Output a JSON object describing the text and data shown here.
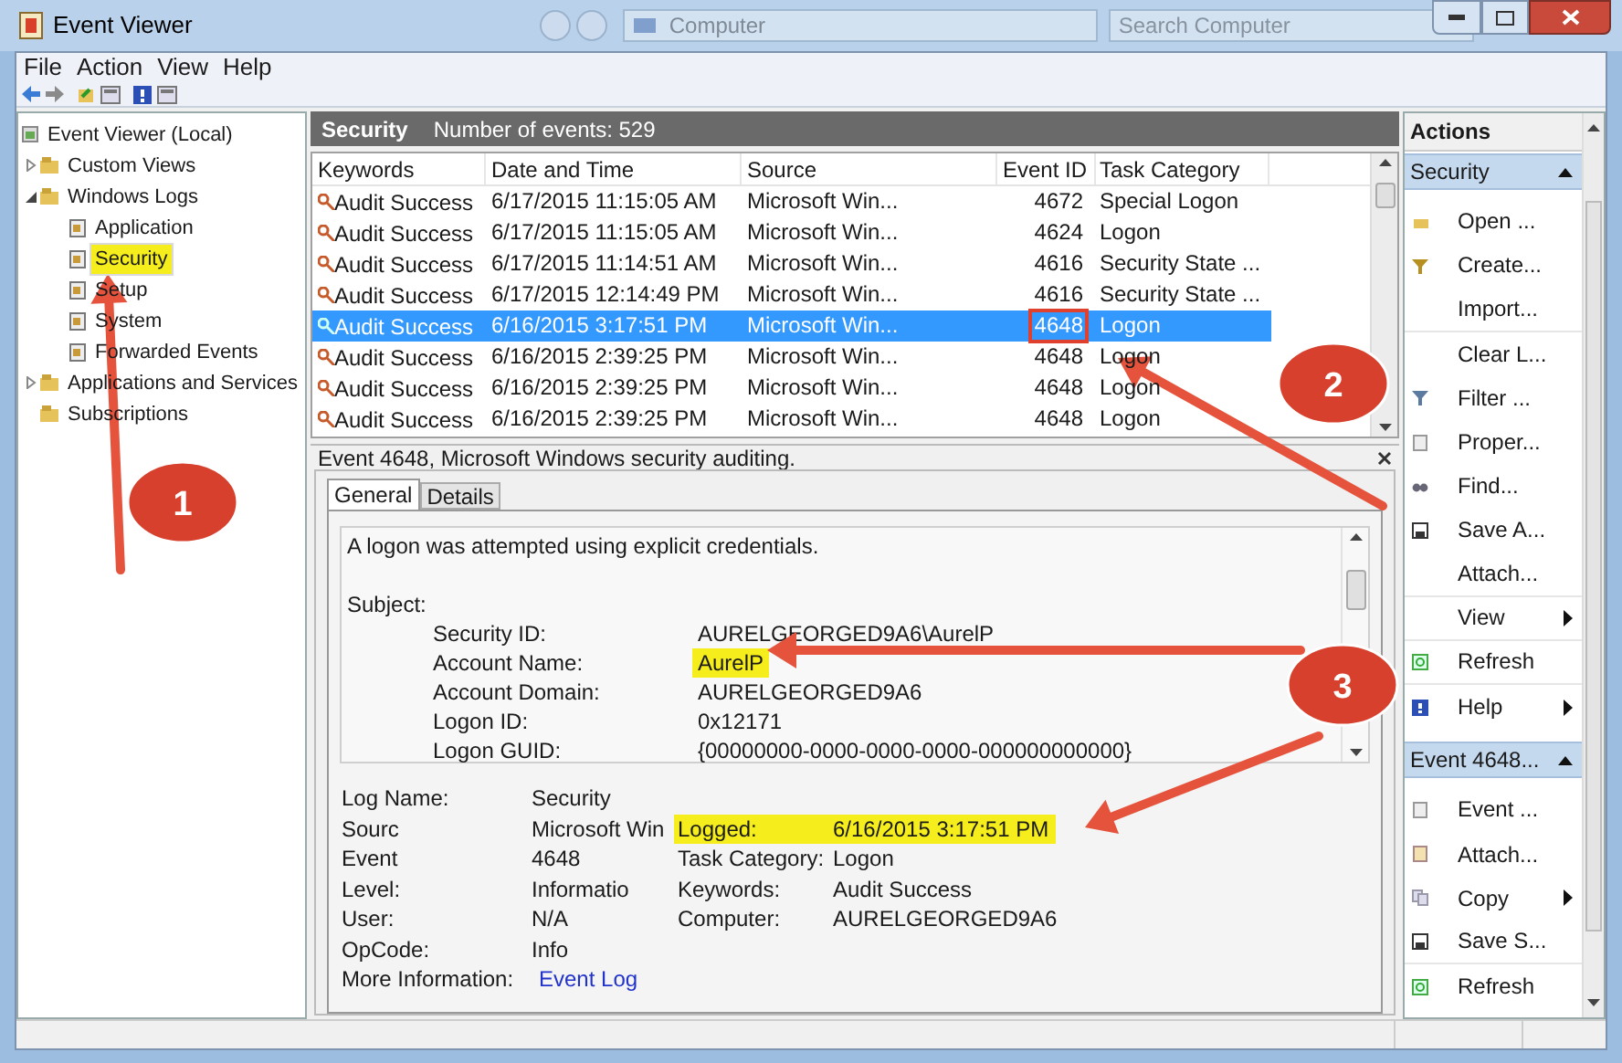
{
  "window": {
    "title": "Event Viewer"
  },
  "background_window": {
    "address": "Computer",
    "search_placeholder": "Search Computer"
  },
  "menu": [
    "File",
    "Action",
    "View",
    "Help"
  ],
  "tree": [
    {
      "label": "Event Viewer (Local)",
      "selected": false,
      "highlighted": false,
      "children": [
        {
          "label": "Custom Views",
          "expanded": false,
          "selected": false,
          "highlighted": false
        },
        {
          "label": "Windows Logs",
          "expanded": true,
          "selected": false,
          "highlighted": false,
          "children": [
            {
              "label": "Application",
              "selected": false,
              "highlighted": false
            },
            {
              "label": "Security",
              "selected": true,
              "highlighted": true
            },
            {
              "label": "Setup",
              "selected": false,
              "highlighted": false
            },
            {
              "label": "System",
              "selected": false,
              "highlighted": false
            },
            {
              "label": "Forwarded Events",
              "selected": false,
              "highlighted": false
            }
          ]
        },
        {
          "label": "Applications and Services",
          "expanded": false,
          "selected": false,
          "highlighted": false
        },
        {
          "label": "Subscriptions",
          "selected": false,
          "highlighted": false
        }
      ]
    }
  ],
  "log_header": {
    "title": "Security",
    "count": "Number of events: 529"
  },
  "table": {
    "columns": [
      "Keywords",
      "Date and Time",
      "Source",
      "Event ID",
      "Task Category"
    ],
    "rows": [
      {
        "keywords": "Audit Success",
        "date": "6/17/2015 11:15:05 AM",
        "source": "Microsoft Win...",
        "event_id": "4672",
        "task": "Special Logon",
        "selected": false,
        "boxed": false
      },
      {
        "keywords": "Audit Success",
        "date": "6/17/2015 11:15:05 AM",
        "source": "Microsoft Win...",
        "event_id": "4624",
        "task": "Logon",
        "selected": false,
        "boxed": false
      },
      {
        "keywords": "Audit Success",
        "date": "6/17/2015 11:14:51 AM",
        "source": "Microsoft Win...",
        "event_id": "4616",
        "task": "Security State ...",
        "selected": false,
        "boxed": false
      },
      {
        "keywords": "Audit Success",
        "date": "6/17/2015 12:14:49 PM",
        "source": "Microsoft Win...",
        "event_id": "4616",
        "task": "Security State ...",
        "selected": false,
        "boxed": false
      },
      {
        "keywords": "Audit Success",
        "date": "6/16/2015 3:17:51 PM",
        "source": "Microsoft Win...",
        "event_id": "4648",
        "task": "Logon",
        "selected": true,
        "boxed": true
      },
      {
        "keywords": "Audit Success",
        "date": "6/16/2015 2:39:25 PM",
        "source": "Microsoft Win...",
        "event_id": "4648",
        "task": "Logon",
        "selected": false,
        "boxed": false
      },
      {
        "keywords": "Audit Success",
        "date": "6/16/2015 2:39:25 PM",
        "source": "Microsoft Win...",
        "event_id": "4648",
        "task": "Logon",
        "selected": false,
        "boxed": false
      },
      {
        "keywords": "Audit Success",
        "date": "6/16/2015 2:39:25 PM",
        "source": "Microsoft Win...",
        "event_id": "4648",
        "task": "Logon",
        "selected": false,
        "boxed": false
      }
    ]
  },
  "detail": {
    "title": "Event 4648, Microsoft Windows security auditing.",
    "tabs": [
      {
        "label": "General",
        "selected": true
      },
      {
        "label": "Details",
        "selected": false
      }
    ],
    "summary": "A logon was attempted using explicit credentials.",
    "section": "Subject:",
    "fields": [
      {
        "label": "Security ID:",
        "value": "AURELGEORGED9A6\\AurelP",
        "highlighted": false
      },
      {
        "label": "Account Name:",
        "value": "AurelP",
        "highlighted": true
      },
      {
        "label": "Account Domain:",
        "value": "AURELGEORGED9A6",
        "highlighted": false
      },
      {
        "label": "Logon ID:",
        "value": "0x12171",
        "highlighted": false
      },
      {
        "label": "Logon GUID:",
        "value": "{00000000-0000-0000-0000-000000000000}",
        "highlighted": false
      }
    ],
    "properties": [
      {
        "label": "Log Name:",
        "value": "Security"
      },
      {
        "label": "Sourc",
        "value": "Microsoft Win",
        "right": {
          "label": "Logged:",
          "value": "6/16/2015 3:17:51 PM",
          "highlighted": true
        }
      },
      {
        "label": "Event",
        "value": "4648",
        "right": {
          "label": "Task Category:",
          "value": "Logon",
          "highlighted": false
        }
      },
      {
        "label": "Level:",
        "value": "Informatio",
        "right": {
          "label": "Keywords:",
          "value": "Audit Success",
          "highlighted": false
        }
      },
      {
        "label": "User:",
        "value": "N/A",
        "right": {
          "label": "Computer:",
          "value": "AURELGEORGED9A6",
          "highlighted": false
        }
      },
      {
        "label": "OpCode:",
        "value": "Info"
      },
      {
        "label": "More Information:",
        "value": "Event Log",
        "kind": "link"
      }
    ]
  },
  "actions": {
    "title": "Actions",
    "sections": [
      {
        "title": "Security",
        "items": [
          {
            "label": "Open ...",
            "submenu": false,
            "separator_after": false
          },
          {
            "label": "Create...",
            "submenu": false,
            "separator_after": false
          },
          {
            "label": "Import...",
            "submenu": false,
            "separator_after": true
          },
          {
            "label": "Clear L...",
            "submenu": false,
            "separator_after": false
          },
          {
            "label": "Filter ...",
            "submenu": false,
            "separator_after": false
          },
          {
            "label": "Proper...",
            "submenu": false,
            "separator_after": false
          },
          {
            "label": "Find...",
            "submenu": false,
            "separator_after": false
          },
          {
            "label": "Save A...",
            "submenu": false,
            "separator_after": false
          },
          {
            "label": "Attach...",
            "submenu": false,
            "separator_after": true
          },
          {
            "label": "View",
            "submenu": true,
            "separator_after": true
          },
          {
            "label": "Refresh",
            "submenu": false,
            "separator_after": true
          },
          {
            "label": "Help",
            "submenu": true,
            "separator_after": false
          }
        ]
      },
      {
        "title": "Event 4648...",
        "items": [
          {
            "label": "Event ...",
            "submenu": false,
            "separator_after": false
          },
          {
            "label": "Attach...",
            "submenu": false,
            "separator_after": false
          },
          {
            "label": "Copy",
            "submenu": true,
            "separator_after": false
          },
          {
            "label": "Save S...",
            "submenu": false,
            "separator_after": true
          },
          {
            "label": "Refresh",
            "submenu": false,
            "separator_after": false
          }
        ]
      }
    ]
  },
  "annotations": [
    {
      "label": "1"
    },
    {
      "label": "2"
    },
    {
      "label": "3"
    }
  ]
}
